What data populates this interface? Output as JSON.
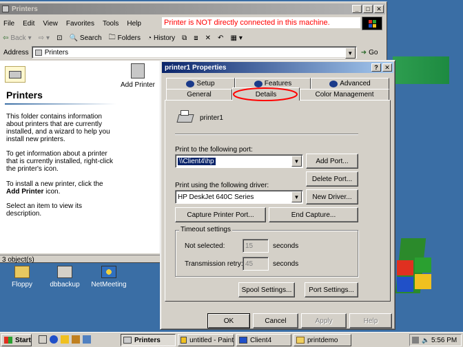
{
  "explorer": {
    "title": "Printers",
    "menu": [
      "File",
      "Edit",
      "View",
      "Favorites",
      "Tools",
      "Help"
    ],
    "notice": "Printer is NOT directly connected in this machine.",
    "toolbar": {
      "back": "Back",
      "search": "Search",
      "folders": "Folders",
      "history": "History"
    },
    "address": {
      "label": "Address",
      "value": "Printers",
      "go": "Go"
    },
    "sidebar": {
      "heading": "Printers",
      "para1": "This folder contains information about printers that are currently installed, and a wizard to help you install new printers.",
      "para2": "To get information about a printer that is currently installed, right-click the printer's icon.",
      "para3_pre": "To install a new printer, click the ",
      "para3_bold": "Add Printer",
      "para3_post": " icon.",
      "para4": "Select an item to view its description."
    },
    "add_printer_label": "Add Printer",
    "status": "3 object(s)"
  },
  "dialog": {
    "title": "printer1 Properties",
    "tabs_back": [
      "Setup",
      "Features",
      "Advanced"
    ],
    "tabs_front": [
      "General",
      "Details",
      "Color Management"
    ],
    "printer_name": "printer1",
    "port_label": "Print to the following port:",
    "port_value": "\\\\Client4\\hp",
    "add_port": "Add Port...",
    "delete_port": "Delete Port...",
    "driver_label": "Print using the following driver:",
    "driver_value": "HP DeskJet 640C Series",
    "new_driver": "New Driver...",
    "capture_port": "Capture Printer Port...",
    "end_capture": "End Capture...",
    "timeout_label": "Timeout settings",
    "not_selected_label": "Not selected:",
    "not_selected_value": "15",
    "transmission_label": "Transmission retry:",
    "transmission_value": "45",
    "seconds": "seconds",
    "spool_settings": "Spool Settings...",
    "port_settings": "Port Settings...",
    "ok": "OK",
    "cancel": "Cancel",
    "apply": "Apply",
    "help": "Help"
  },
  "desktop": {
    "icons": [
      "Floppy",
      "dbbackup",
      "NetMeeting"
    ]
  },
  "taskbar": {
    "start": "Start",
    "tasks": [
      "Printers",
      "untitled - Paint",
      "Client4",
      "printdemo"
    ],
    "clock": "5:56 PM"
  },
  "colors": {
    "desktop": "#3a6ea5",
    "active_title": "#0a246a",
    "notice_text": "#ff0000",
    "highlight_circle": "#ff0000"
  }
}
